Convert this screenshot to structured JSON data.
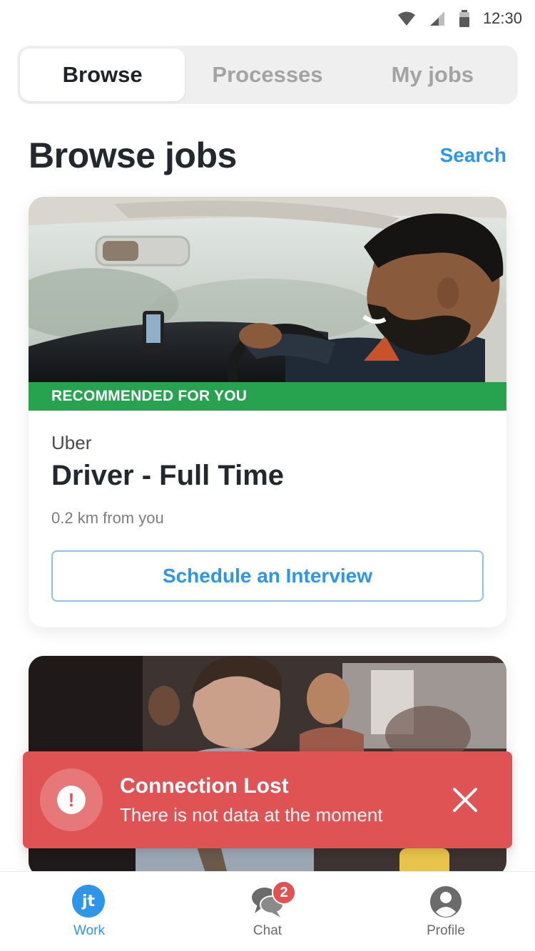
{
  "status_bar": {
    "time": "12:30",
    "icons": [
      "wifi-icon",
      "cell-signal-icon",
      "battery-icon"
    ]
  },
  "tabs": [
    {
      "label": "Browse",
      "active": true
    },
    {
      "label": "Processes",
      "active": false
    },
    {
      "label": "My jobs",
      "active": false
    }
  ],
  "header": {
    "title": "Browse jobs",
    "search_label": "Search"
  },
  "jobs": [
    {
      "image": "driver-photo",
      "banner": "RECOMMENDED FOR YOU",
      "company": "Uber",
      "title": "Driver - Full Time",
      "distance": "0.2 km from you",
      "action_label": "Schedule an Interview"
    },
    {
      "image": "restaurant-staff-photo"
    }
  ],
  "toast": {
    "title": "Connection Lost",
    "message": "There is not data at the moment",
    "icon": "alert-icon",
    "close_icon": "close-icon"
  },
  "bottom_nav": {
    "items": [
      {
        "label": "Work",
        "icon": "jt-logo-icon",
        "active": true,
        "logo_text": "jt"
      },
      {
        "label": "Chat",
        "icon": "chat-icon",
        "active": false,
        "badge": "2"
      },
      {
        "label": "Profile",
        "icon": "profile-icon",
        "active": false
      }
    ]
  },
  "colors": {
    "accent": "#2d96e8",
    "recommended": "#27a24f",
    "error": "#e05354"
  }
}
